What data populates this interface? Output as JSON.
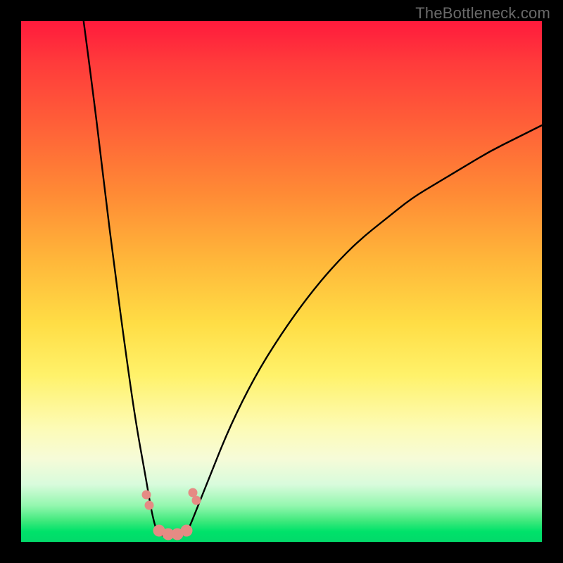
{
  "watermark": "TheBottleneck.com",
  "colors": {
    "background": "#000000",
    "gradient_top": "#ff1a3c",
    "gradient_bottom": "#02d96a",
    "curve": "#000000",
    "marker": "#e58b84"
  },
  "chart_data": {
    "type": "line",
    "title": "",
    "xlabel": "",
    "ylabel": "",
    "xlim": [
      0,
      100
    ],
    "ylim": [
      0,
      100
    ],
    "description": "V-shaped bottleneck curve: a steep descending branch from x≈12 at y=100 down to a flat minimum near x≈26-32, then a rising concave branch out to x=100 at y≈80.",
    "left_branch": {
      "x": [
        12,
        14,
        16,
        18,
        20,
        22,
        24,
        25,
        26
      ],
      "y": [
        100,
        85,
        68,
        52,
        37,
        23,
        12,
        6,
        2
      ]
    },
    "basin": {
      "x": [
        26,
        27,
        28,
        29,
        30,
        31,
        32
      ],
      "y": [
        2,
        1.2,
        1,
        1,
        1,
        1.2,
        2
      ]
    },
    "right_branch": {
      "x": [
        32,
        34,
        36,
        40,
        45,
        50,
        55,
        60,
        65,
        70,
        75,
        80,
        85,
        90,
        95,
        100
      ],
      "y": [
        2,
        7,
        12,
        22,
        32,
        40,
        47,
        53,
        58,
        62,
        66,
        69,
        72,
        75,
        77.5,
        80
      ]
    },
    "markers_small": [
      {
        "x": 24.0,
        "y": 9.0
      },
      {
        "x": 24.6,
        "y": 7.0
      },
      {
        "x": 33.0,
        "y": 9.5
      },
      {
        "x": 33.6,
        "y": 8.0
      }
    ],
    "markers_large": [
      {
        "x": 26.5,
        "y": 2.2
      },
      {
        "x": 28.2,
        "y": 1.5
      },
      {
        "x": 30.0,
        "y": 1.5
      },
      {
        "x": 31.7,
        "y": 2.2
      }
    ]
  }
}
